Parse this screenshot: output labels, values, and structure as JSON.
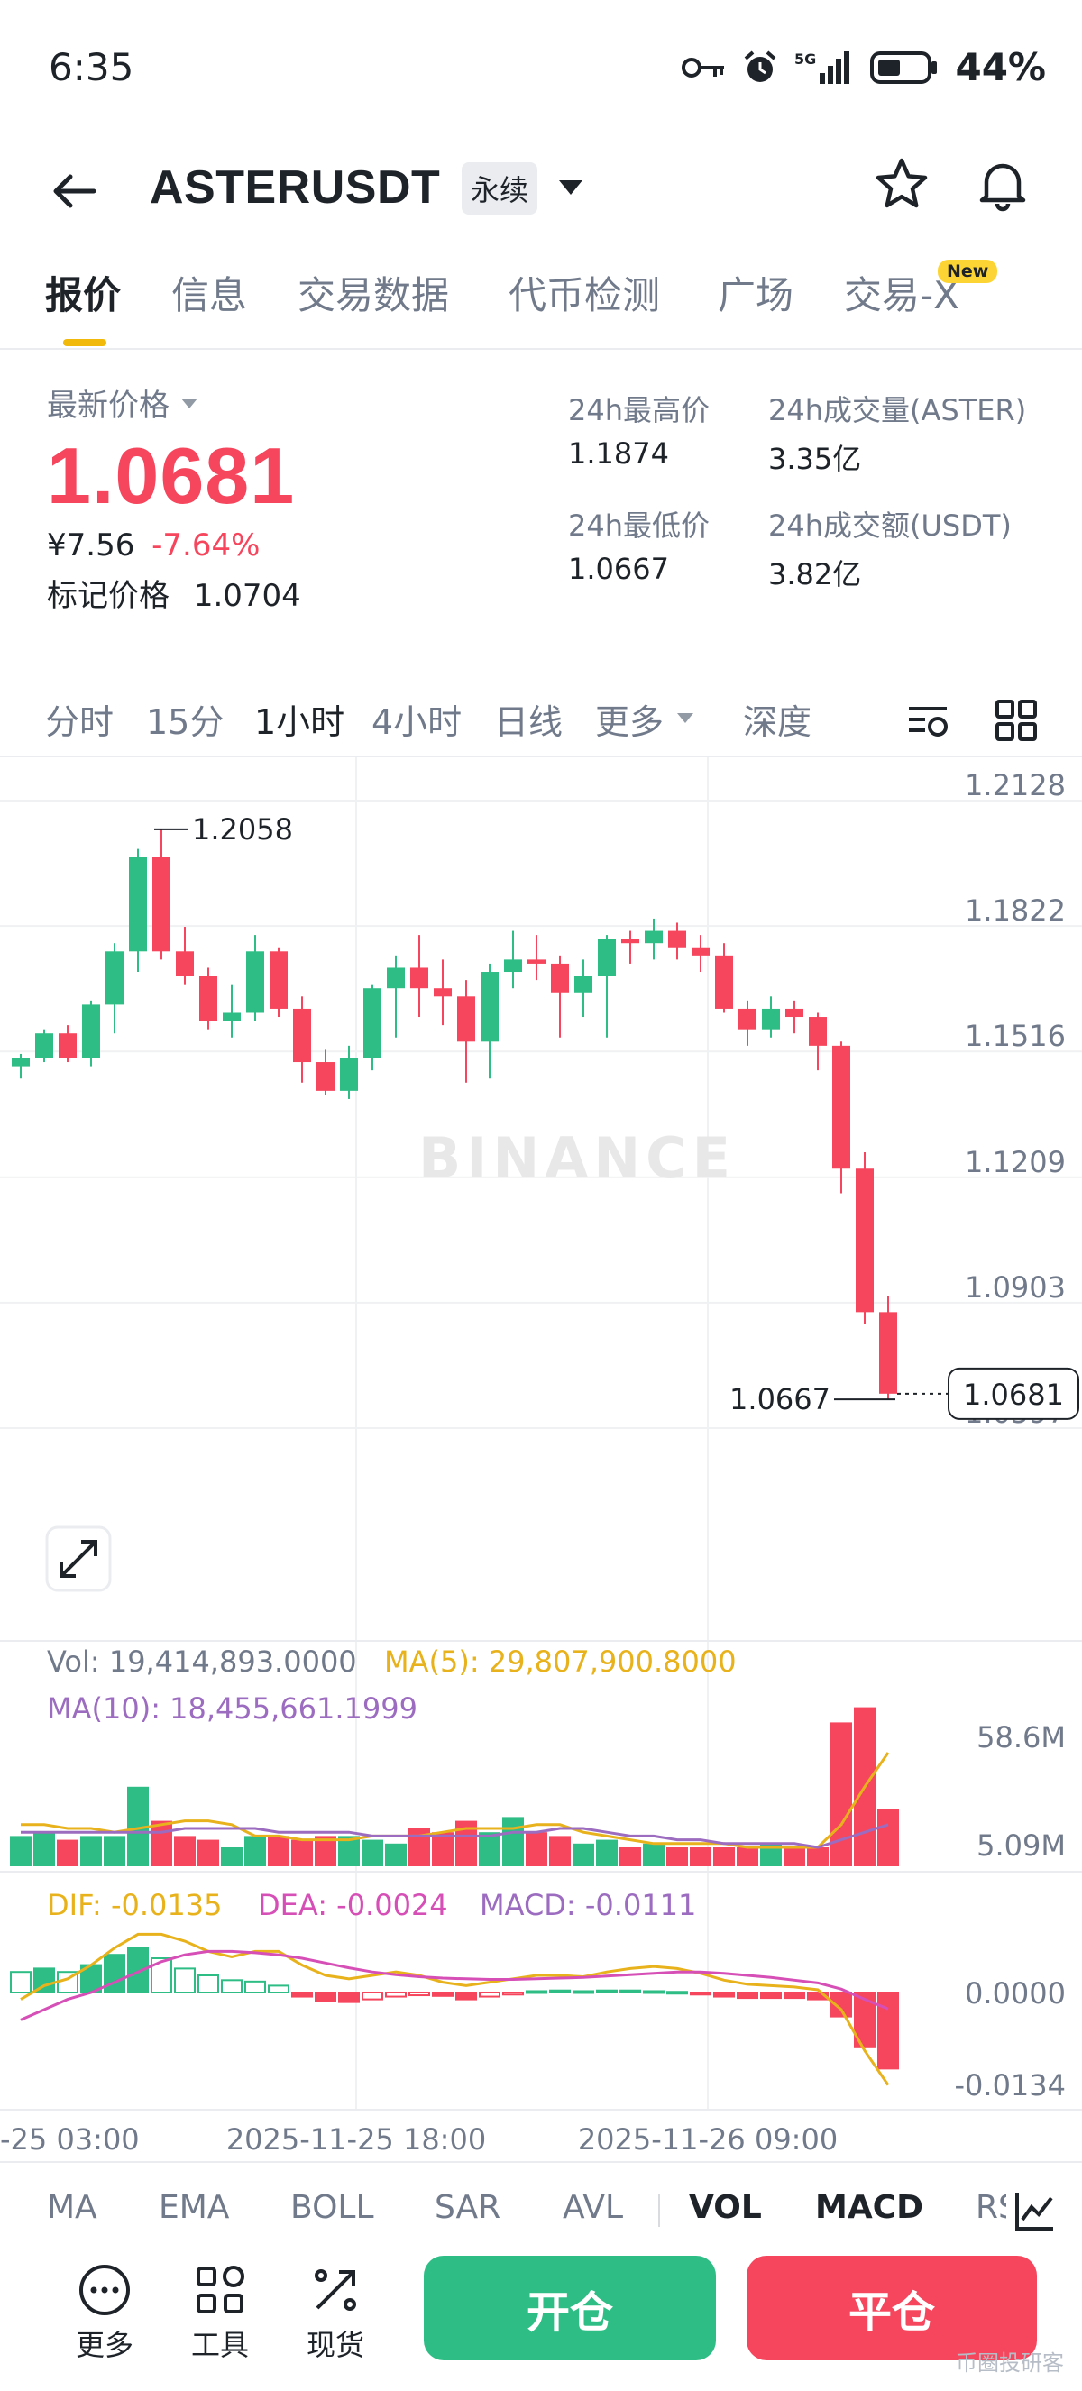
{
  "status": {
    "time": "6:35",
    "battery": "44%",
    "network": "5G"
  },
  "header": {
    "symbol": "ASTERUSDT",
    "contract_tag": "永续"
  },
  "tabs": [
    {
      "label": "报价"
    },
    {
      "label": "信息"
    },
    {
      "label": "交易数据"
    },
    {
      "label": "代币检测"
    },
    {
      "label": "广场"
    },
    {
      "label": "交易-X"
    }
  ],
  "new_badge": "New",
  "price": {
    "label": "最新价格",
    "last": "1.0681",
    "cny": "¥7.56",
    "change": "-7.64%",
    "mark_label": "标记价格",
    "mark": "1.0704"
  },
  "stats": {
    "high_label": "24h最高价",
    "high": "1.1874",
    "low_label": "24h最低价",
    "low": "1.0667",
    "vol_label": "24h成交量(ASTER)",
    "vol": "3.35亿",
    "amt_label": "24h成交额(USDT)",
    "amt": "3.82亿"
  },
  "intervals": [
    {
      "label": "分时"
    },
    {
      "label": "15分"
    },
    {
      "label": "1小时"
    },
    {
      "label": "4小时"
    },
    {
      "label": "日线"
    },
    {
      "label": "更多"
    },
    {
      "label": "深度"
    }
  ],
  "chart_data": {
    "type": "candlestick",
    "watermark": "BINANCE",
    "y_ticks": [
      "1.2128",
      "1.1822",
      "1.1516",
      "1.1209",
      "1.0903",
      "1.0597"
    ],
    "ylim": [
      1.0597,
      1.2128
    ],
    "high_marker": "1.2058",
    "low_marker": "1.0667",
    "last_price_tag": "1.0681",
    "x_ticks": [
      "-25 03:00",
      "2025-11-25 18:00",
      "2025-11-26 09:00"
    ],
    "candles": [
      [
        1.148,
        1.15,
        1.145,
        1.151
      ],
      [
        1.15,
        1.156,
        1.149,
        1.157
      ],
      [
        1.156,
        1.15,
        1.149,
        1.158
      ],
      [
        1.15,
        1.163,
        1.148,
        1.164
      ],
      [
        1.163,
        1.176,
        1.156,
        1.178
      ],
      [
        1.176,
        1.199,
        1.171,
        1.201
      ],
      [
        1.199,
        1.176,
        1.174,
        1.2058
      ],
      [
        1.176,
        1.17,
        1.168,
        1.182
      ],
      [
        1.17,
        1.159,
        1.157,
        1.172
      ],
      [
        1.159,
        1.161,
        1.155,
        1.168
      ],
      [
        1.161,
        1.176,
        1.159,
        1.18
      ],
      [
        1.176,
        1.162,
        1.16,
        1.177
      ],
      [
        1.162,
        1.149,
        1.144,
        1.165
      ],
      [
        1.149,
        1.142,
        1.141,
        1.152
      ],
      [
        1.142,
        1.15,
        1.14,
        1.153
      ],
      [
        1.15,
        1.167,
        1.147,
        1.168
      ],
      [
        1.167,
        1.172,
        1.155,
        1.175
      ],
      [
        1.172,
        1.167,
        1.16,
        1.18
      ],
      [
        1.167,
        1.165,
        1.158,
        1.174
      ],
      [
        1.165,
        1.154,
        1.144,
        1.169
      ],
      [
        1.154,
        1.171,
        1.145,
        1.173
      ],
      [
        1.171,
        1.174,
        1.167,
        1.181
      ],
      [
        1.174,
        1.173,
        1.169,
        1.18
      ],
      [
        1.173,
        1.166,
        1.155,
        1.175
      ],
      [
        1.166,
        1.17,
        1.16,
        1.174
      ],
      [
        1.17,
        1.179,
        1.155,
        1.18
      ],
      [
        1.179,
        1.178,
        1.173,
        1.181
      ],
      [
        1.178,
        1.181,
        1.174,
        1.184
      ],
      [
        1.181,
        1.177,
        1.174,
        1.183
      ],
      [
        1.177,
        1.175,
        1.171,
        1.18
      ],
      [
        1.175,
        1.162,
        1.161,
        1.178
      ],
      [
        1.162,
        1.157,
        1.153,
        1.164
      ],
      [
        1.157,
        1.162,
        1.155,
        1.165
      ],
      [
        1.162,
        1.16,
        1.156,
        1.164
      ],
      [
        1.16,
        1.153,
        1.147,
        1.161
      ],
      [
        1.153,
        1.123,
        1.117,
        1.154
      ],
      [
        1.123,
        1.088,
        1.085,
        1.127
      ],
      [
        1.088,
        1.0681,
        1.0667,
        1.092
      ]
    ],
    "volume": {
      "label": "Vol: 19,414,893.0000",
      "ma5_label": "MA(5): 29,807,900.8000",
      "ma10_label": "MA(10): 18,455,661.1999",
      "ticks": [
        "58.6M",
        "5.09M"
      ],
      "values": [
        8,
        9,
        7,
        8,
        8,
        21,
        12,
        8,
        7,
        5,
        8,
        8,
        7,
        8,
        8,
        7,
        6,
        10,
        9,
        12,
        9,
        13,
        9,
        8,
        6,
        7,
        5,
        6,
        5,
        5,
        5,
        5,
        6,
        5,
        5,
        38,
        42,
        15
      ],
      "ma5": [
        11,
        11,
        10,
        10,
        9,
        10,
        11,
        12,
        12,
        11,
        8,
        8,
        7,
        7,
        7,
        8,
        8,
        8,
        9,
        10,
        10,
        10,
        11,
        11,
        9,
        8,
        7,
        6,
        6,
        6,
        6,
        5,
        5,
        5,
        5,
        11,
        21,
        30
      ],
      "ma10": [
        9,
        9,
        9,
        9,
        9,
        9,
        9,
        10,
        10,
        10,
        10,
        9,
        9,
        9,
        9,
        8,
        8,
        8,
        8,
        8,
        8,
        9,
        9,
        10,
        10,
        9,
        8,
        8,
        7,
        7,
        6,
        6,
        6,
        6,
        5,
        7,
        9,
        11
      ]
    },
    "macd": {
      "dif_label": "DIF: -0.0135",
      "dea_label": "DEA: -0.0024",
      "macd_label": "MACD: -0.0111",
      "ticks": [
        "0.0000",
        "-0.0134"
      ],
      "hist": [
        0.003,
        0.0035,
        0.003,
        0.004,
        0.0055,
        0.0065,
        0.005,
        0.0035,
        0.0025,
        0.0018,
        0.0016,
        0.001,
        -0.0006,
        -0.0012,
        -0.0014,
        -0.001,
        -0.0006,
        -0.0004,
        -0.0005,
        -0.001,
        -0.0006,
        -0.0003,
        0.0002,
        0.0003,
        0.0002,
        0.0003,
        0.0003,
        0.0002,
        0.0001,
        -0.0003,
        -0.0006,
        -0.0008,
        -0.0008,
        -0.0008,
        -0.001,
        -0.0035,
        -0.008,
        -0.0111
      ],
      "dif": [
        -0.001,
        0.001,
        0.002,
        0.004,
        0.0065,
        0.0085,
        0.0085,
        0.0075,
        0.006,
        0.0052,
        0.006,
        0.006,
        0.004,
        0.0025,
        0.002,
        0.0025,
        0.003,
        0.0025,
        0.0015,
        0.001,
        0.0015,
        0.002,
        0.0025,
        0.0025,
        0.0023,
        0.003,
        0.0035,
        0.0038,
        0.0035,
        0.0028,
        0.0018,
        0.0012,
        0.001,
        0.0008,
        0.0004,
        -0.0025,
        -0.0085,
        -0.0135
      ],
      "dea": [
        -0.004,
        -0.0025,
        -0.001,
        0.0,
        0.0015,
        0.003,
        0.0045,
        0.0055,
        0.006,
        0.006,
        0.0058,
        0.0055,
        0.005,
        0.0043,
        0.0036,
        0.003,
        0.0026,
        0.0023,
        0.0021,
        0.002,
        0.0019,
        0.0019,
        0.002,
        0.0021,
        0.0022,
        0.0024,
        0.0026,
        0.0028,
        0.003,
        0.003,
        0.0028,
        0.0025,
        0.0022,
        0.0018,
        0.0014,
        0.0005,
        -0.001,
        -0.0024
      ]
    }
  },
  "indicator_tabs": [
    {
      "label": "MA"
    },
    {
      "label": "EMA"
    },
    {
      "label": "BOLL"
    },
    {
      "label": "SAR"
    },
    {
      "label": "AVL"
    },
    {
      "label": "VOL"
    },
    {
      "label": "MACD"
    },
    {
      "label": "RS"
    }
  ],
  "tools": [
    {
      "label": "更多"
    },
    {
      "label": "工具"
    },
    {
      "label": "现货"
    }
  ],
  "actions": {
    "open": "开仓",
    "close": "平仓"
  },
  "watermark_corner": "币圈投研客",
  "colors": {
    "up": "#2ebd85",
    "down": "#f6465d",
    "accent": "#f0b90b",
    "ma5": "#e8b21c",
    "ma10": "#9b6cbf",
    "dea": "#d64fb7"
  }
}
